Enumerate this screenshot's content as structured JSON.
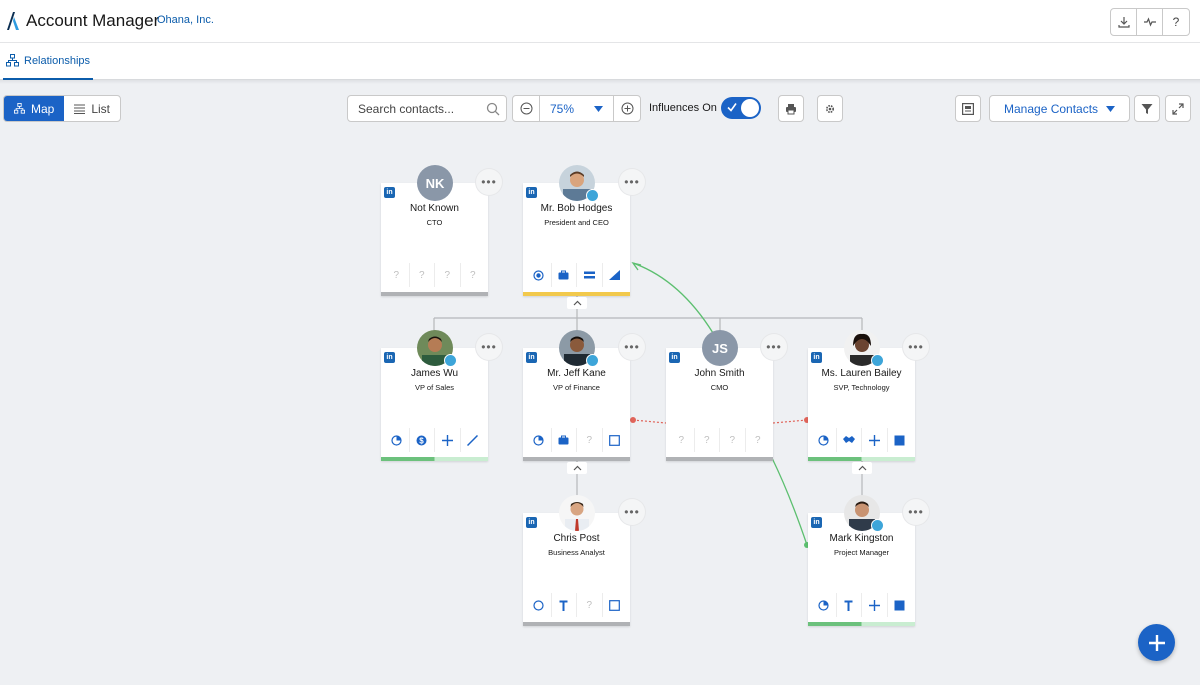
{
  "header": {
    "app_title": "Account Manager",
    "company": "Ohana, Inc.",
    "buttons": [
      {
        "icon": "download-icon"
      },
      {
        "icon": "activity-icon"
      },
      {
        "icon": "help-icon",
        "label": "?"
      }
    ]
  },
  "tabs": [
    {
      "label": "Relationships",
      "icon": "hierarchy-icon",
      "active": true
    }
  ],
  "toolbar": {
    "view_toggle": {
      "map_label": "Map",
      "list_label": "List",
      "selected": "Map"
    },
    "search": {
      "placeholder": "Search contacts...",
      "value": ""
    },
    "zoom": {
      "value": "75%"
    },
    "influences": {
      "label": "Influences On",
      "checked": true
    },
    "manage_contacts_label": "Manage Contacts"
  },
  "contacts": [
    {
      "name": "Not Known",
      "title": "CTO",
      "initials": "NK",
      "icon_labels": [
        "?",
        "?",
        "?",
        "?"
      ],
      "status": "gray"
    },
    {
      "name": "Mr. Bob Hodges",
      "title": "President and CEO",
      "initials": "",
      "status": "yellow"
    },
    {
      "name": "James Wu",
      "title": "VP of Sales",
      "initials": "",
      "status": "green"
    },
    {
      "name": "Mr. Jeff Kane",
      "title": "VP of Finance",
      "initials": "",
      "icon_labels": [
        "?"
      ],
      "status": "gray"
    },
    {
      "name": "John Smith",
      "title": "CMO",
      "initials": "JS",
      "icon_labels": [
        "?",
        "?",
        "?",
        "?"
      ],
      "status": "gray"
    },
    {
      "name": "Ms. Lauren Bailey",
      "title": "SVP, Technology",
      "initials": "",
      "status": "green"
    },
    {
      "name": "Chris Post",
      "title": "Business Analyst",
      "initials": "",
      "icon_labels": [
        "?"
      ],
      "status": "gray"
    },
    {
      "name": "Mark Kingston",
      "title": "Project Manager",
      "initials": "",
      "status": "green"
    }
  ],
  "colors": {
    "accent": "#1b63c6",
    "influence_positive": "#5cbf6f",
    "influence_negative": "#e0645a",
    "status_yellow": "#f2c94c",
    "status_green": "#6cc17c"
  }
}
